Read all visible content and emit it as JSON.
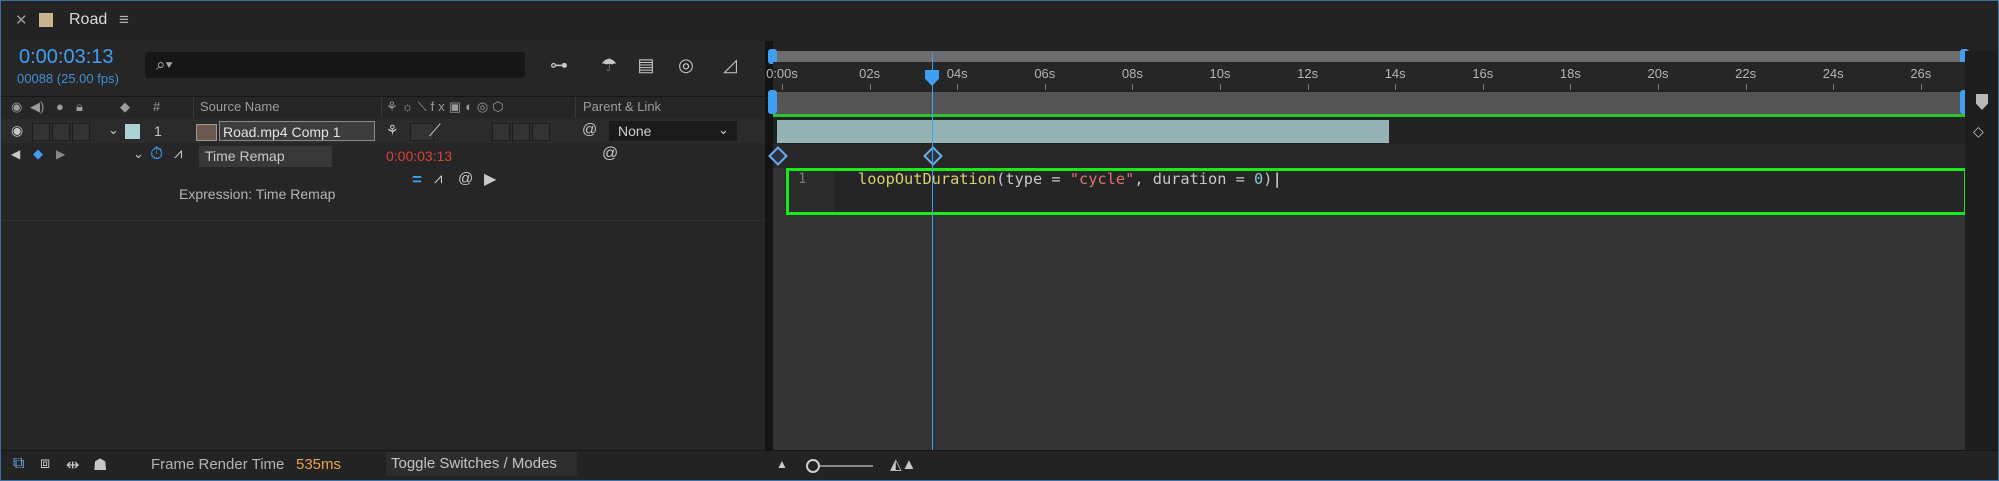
{
  "tab": {
    "title": "Road",
    "close_icon": "close-icon",
    "menu_icon": "hamburger-menu-icon",
    "swatch_color": "#c8b48f"
  },
  "timecode": {
    "current": "0:00:03:13",
    "frames": "00088 (25.00 fps)"
  },
  "search": {
    "placeholder": ""
  },
  "columns": {
    "source_name": "Source Name",
    "parent_link": "Parent & Link",
    "number": "#"
  },
  "layer": {
    "number": "1",
    "name": "Road.mp4 Comp 1",
    "parent": "None",
    "label_color": "#a9d4d1"
  },
  "property": {
    "name": "Time Remap",
    "value": "0:00:03:13"
  },
  "expression": {
    "label": "Expression: Time Remap",
    "line_number": "1",
    "code_fn": "loopOutDuration",
    "code_mid1": "(type = ",
    "code_str": "\"cycle\"",
    "code_mid2": ", duration = ",
    "code_num": "0",
    "code_end": ")"
  },
  "ruler": {
    "labels": [
      "0:00s",
      "02s",
      "04s",
      "06s",
      "08s",
      "10s",
      "12s",
      "14s",
      "16s",
      "18s",
      "20s",
      "22s",
      "24s",
      "26s"
    ]
  },
  "status": {
    "render_label": "Frame Render Time",
    "render_value": "535ms",
    "toggle_label": "Toggle Switches / Modes"
  },
  "colors": {
    "accent": "#3f9ff2",
    "highlight_box": "#19ea19",
    "time_red": "#d9443c"
  }
}
